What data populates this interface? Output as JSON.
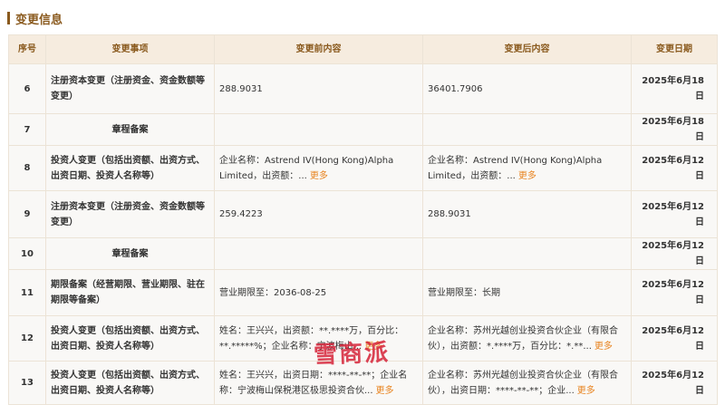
{
  "section": {
    "title": "变更信息"
  },
  "table": {
    "headers": [
      "序号",
      "变更事项",
      "变更前内容",
      "变更后内容",
      "变更日期"
    ],
    "more_label": "更多",
    "rows": [
      {
        "no": "6",
        "item": "注册资本变更（注册资金、资金数额等变更）",
        "before": "288.9031",
        "after": "36401.7906",
        "date": "2025年6月18日"
      },
      {
        "no": "7",
        "item": "章程备案",
        "before": "",
        "after": "",
        "date": "2025年6月18日"
      },
      {
        "no": "8",
        "item": "投资人变更（包括出资额、出资方式、出资日期、投资人名称等）",
        "before": "企业名称：Astrend IV(Hong Kong)Alpha Limited，出资额：...",
        "after": "企业名称：Astrend IV(Hong Kong)Alpha Limited，出资额：...",
        "date": "2025年6月12日"
      },
      {
        "no": "9",
        "item": "注册资本变更（注册资金、资金数额等变更）",
        "before": "259.4223",
        "after": "288.9031",
        "date": "2025年6月12日"
      },
      {
        "no": "10",
        "item": "章程备案",
        "before": "",
        "after": "",
        "date": "2025年6月12日"
      },
      {
        "no": "11",
        "item": "期限备案（经营期限、营业期限、驻在期限等备案）",
        "before": "营业期限至：2036-08-25",
        "after": "营业期限至：长期",
        "date": "2025年6月12日"
      },
      {
        "no": "12",
        "item": "投资人变更（包括出资额、出资方式、出资日期、投资人名称等）",
        "before": "姓名：王兴兴，出资额：**.****万，百分比：**.*****%；企业名称：宁波梅山...",
        "after": "企业名称：苏州光越创业投资合伙企业（有限合伙），出资额：*.****万，百分比：*.**...",
        "date": "2025年6月12日"
      },
      {
        "no": "13",
        "item": "投资人变更（包括出资额、出资方式、出资日期、投资人名称等）",
        "before": "姓名：王兴兴，出资日期：****-**-**；企业名称：宁波梅山保税港区极思投资合伙...",
        "after": "企业名称：苏州光越创业投资合伙企业（有限合伙），出资日期：****-**-**；企业...",
        "date": "2025年6月12日"
      }
    ]
  },
  "watermark": "雪商派"
}
